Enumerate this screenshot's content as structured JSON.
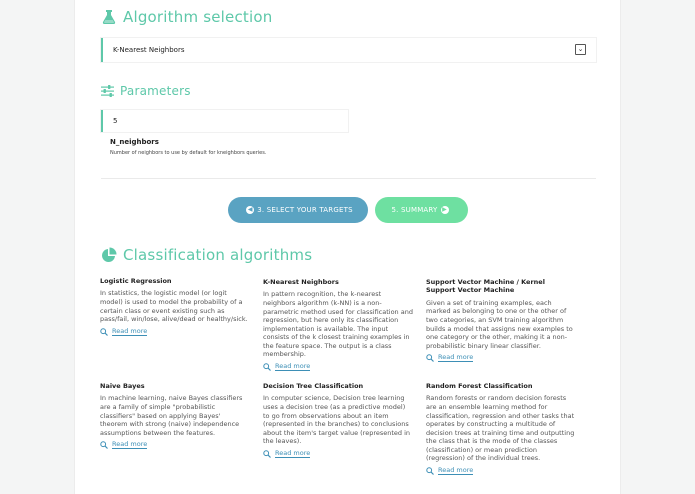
{
  "algorithm_selection": {
    "title": "Algorithm selection",
    "selected": "K-Nearest Neighbors"
  },
  "parameters": {
    "title": "Parameters",
    "value": "5",
    "name": "N_neighbors",
    "help": "Number of neighbors to use by default for kneighbors queries."
  },
  "nav": {
    "back_label": "3. SELECT YOUR TARGETS",
    "next_label": "5. SUMMARY"
  },
  "classification": {
    "title": "Classification algorithms",
    "read_more": "Read more",
    "algorithms": [
      {
        "name": "Logistic Regression",
        "description": "In statistics, the logistic model (or logit model) is used to model the probability of a certain class or event existing such as pass/fail, win/lose, alive/dead or healthy/sick."
      },
      {
        "name": "K-Nearest Neighbors",
        "description": "In pattern recognition, the k-nearest neighbors algorithm (k-NN) is a non-parametric method used for classification and regression, but here only its classification implementation is available. The input consists of the k closest training examples in the feature space. The output is a class membership."
      },
      {
        "name": "Support Vector Machine / Kernel Support Vector Machine",
        "description": "Given a set of training examples, each marked as belonging to one or the other of two categories, an SVM training algorithm builds a model that assigns new examples to one category or the other, making it a non-probabilistic binary linear classifier."
      },
      {
        "name": "Naive Bayes",
        "description": "In machine learning, naive Bayes classifiers are a family of simple \"probabilistic classifiers\" based on applying Bayes' theorem with strong (naive) independence assumptions between the features."
      },
      {
        "name": "Decision Tree Classification",
        "description": "In computer science, Decision tree learning uses a decision tree (as a predictive model) to go from observations about an item (represented in the branches) to conclusions about the item's target value (represented in the leaves)."
      },
      {
        "name": "Random Forest Classification",
        "description": "Random forests or random decision forests are an ensemble learning method for classification, regression and other tasks that operates by constructing a multitude of decision trees at training time and outputting the class that is the mode of the classes (classification) or mean prediction (regression) of the individual trees."
      }
    ]
  },
  "colors": {
    "accent": "#5ec8a9",
    "back_button": "#5aa3c2",
    "next_button": "#6ee0a1",
    "link": "#3d8fb6"
  }
}
